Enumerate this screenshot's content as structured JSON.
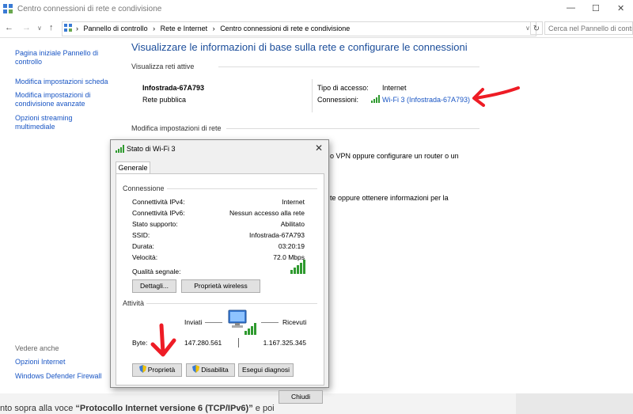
{
  "window": {
    "title": "Centro connessioni di rete e condivisione",
    "minimize": "—",
    "maximize": "☐",
    "close": "✕"
  },
  "address": {
    "breadcrumbs": [
      "Pannello di controllo",
      "Rete e Internet",
      "Centro connessioni di rete e condivisione"
    ],
    "search_placeholder": "Cerca nel Pannello di controllo"
  },
  "sidebar": {
    "items": [
      "Pagina iniziale Pannello di controllo",
      "Modifica impostazioni scheda",
      "Modifica impostazioni di condivisione avanzate",
      "Opzioni streaming multimediale"
    ],
    "see_also_label": "Vedere anche",
    "see_also": [
      "Opzioni Internet",
      "Windows Defender Firewall"
    ]
  },
  "main": {
    "heading": "Visualizzare le informazioni di base sulla rete e configurare le connessioni",
    "active_networks_title": "Visualizza reti attive",
    "network_name": "Infostrada-67A793",
    "network_type": "Rete pubblica",
    "access_type_label": "Tipo di accesso:",
    "access_type_value": "Internet",
    "connections_label": "Connessioni:",
    "connections_value": "Wi-Fi 3 (Infostrada-67A793)",
    "change_settings_title": "Modifica impostazioni di rete",
    "partial_text_1": "o VPN oppure configurare un router o un",
    "partial_text_2": "te oppure ottenere informazioni per la"
  },
  "dialog": {
    "title": "Stato di Wi-Fi 3",
    "tab": "Generale",
    "connection_group": "Connessione",
    "rows": [
      {
        "label": "Connettività IPv4:",
        "value": "Internet"
      },
      {
        "label": "Connettività IPv6:",
        "value": "Nessun accesso alla rete"
      },
      {
        "label": "Stato supporto:",
        "value": "Abilitato"
      },
      {
        "label": "SSID:",
        "value": "Infostrada-67A793"
      },
      {
        "label": "Durata:",
        "value": "03:20:19"
      },
      {
        "label": "Velocità:",
        "value": "72.0 Mbps"
      }
    ],
    "signal_label": "Qualità segnale:",
    "details_button": "Dettagli...",
    "wireless_button": "Proprietà wireless",
    "activity_group": "Attività",
    "sent_label": "Inviati",
    "received_label": "Ricevuti",
    "bytes_label": "Byte:",
    "bytes_sent": "147.280.561",
    "bytes_received": "1.167.325.345",
    "properties_button": "Proprietà",
    "disable_button": "Disabilita",
    "diagnose_button": "Esegui diagnosi",
    "close_button": "Chiudi"
  },
  "bottom": {
    "text_prefix": "nto sopra alla voce ",
    "text_bold": "“Protocollo Internet versione 6 (TCP/IPv6)”",
    "text_suffix": " e poi"
  },
  "colors": {
    "link": "#1a56c4",
    "heading": "#1b4d9a",
    "annotation_arrow": "#ee1c25",
    "signal": "#2f9a2f"
  }
}
